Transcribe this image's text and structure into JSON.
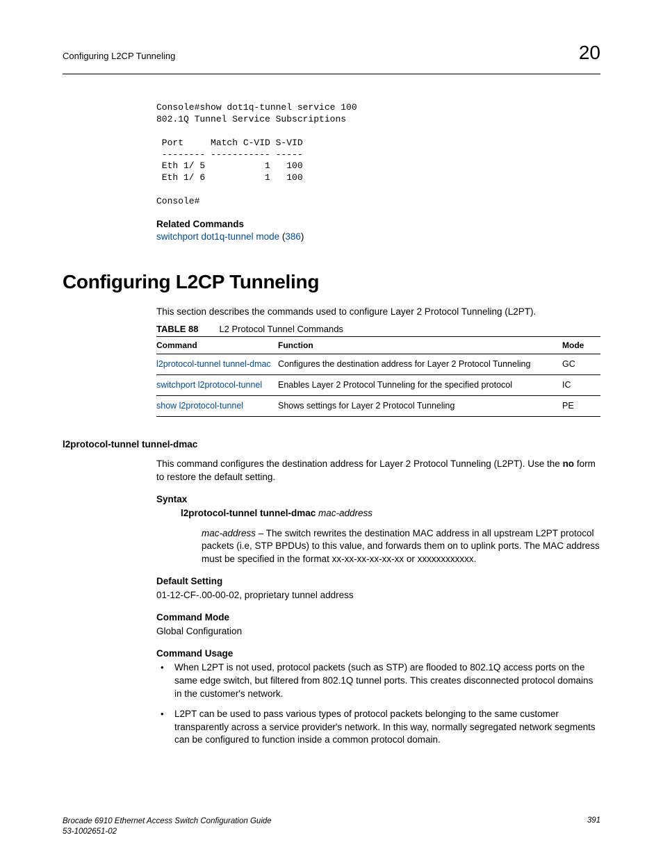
{
  "running_head": {
    "title": "Configuring L2CP Tunneling",
    "chapter_number": "20"
  },
  "console_output": "Console#show dot1q-tunnel service 100\n802.1Q Tunnel Service Subscriptions\n\n Port     Match C-VID S-VID\n -------- ----------- -----\n Eth 1/ 5           1   100\n Eth 1/ 6           1   100\n\nConsole#",
  "related_commands": {
    "heading": "Related Commands",
    "link_text": "switchport dot1q-tunnel mode",
    "link_page": "386"
  },
  "h1": "Configuring L2CP Tunneling",
  "intro": "This section describes the commands used to configure Layer 2 Protocol Tunneling (L2PT).",
  "table": {
    "caption_label": "TABLE 88",
    "caption_text": "L2 Protocol Tunnel Commands",
    "headers": {
      "cmd": "Command",
      "func": "Function",
      "mode": "Mode"
    },
    "rows": [
      {
        "cmd": "l2protocol-tunnel tunnel-dmac",
        "func": "Configures the destination address for Layer 2 Protocol Tunneling",
        "mode": "GC"
      },
      {
        "cmd": "switchport l2protocol-tunnel",
        "func": "Enables Layer 2 Protocol Tunneling for the specified protocol",
        "mode": "IC"
      },
      {
        "cmd": "show l2protocol-tunnel",
        "func": "Shows settings for Layer 2 Protocol Tunneling",
        "mode": "PE"
      }
    ]
  },
  "subsection": {
    "title": "l2protocol-tunnel tunnel-dmac",
    "desc_pre": "This command configures the destination address for Layer 2 Protocol Tunneling (L2PT). Use the ",
    "desc_bold": "no",
    "desc_post": " form to restore the default setting.",
    "syntax_label": "Syntax",
    "syntax_cmd": "l2protocol-tunnel tunnel-dmac",
    "syntax_arg": "mac-address",
    "syntax_desc_arg": "mac-address",
    "syntax_desc_text": " – The switch rewrites the destination MAC address in all upstream L2PT protocol packets (i.e, STP BPDUs) to this value, and forwards them on to uplink ports. The MAC address must be specified in the format xx-xx-xx-xx-xx-xx or xxxxxxxxxxxx.",
    "default_label": "Default Setting",
    "default_text": "01-12-CF-.00-00-02, proprietary tunnel address",
    "mode_label": "Command Mode",
    "mode_text": "Global Configuration",
    "usage_label": "Command Usage",
    "usage": [
      "When L2PT is not used, protocol packets (such as STP) are flooded to 802.1Q access ports on the same edge switch, but filtered from 802.1Q tunnel ports. This creates disconnected protocol domains in the customer's network.",
      "L2PT can be used to pass various types of protocol packets belonging to the same customer transparently across a service provider's network. In this way, normally segregated network segments can be configured to function inside a common protocol domain."
    ]
  },
  "footer": {
    "line1": "Brocade 6910 Ethernet Access Switch Configuration Guide",
    "line2": "53-1002651-02",
    "page": "391"
  }
}
